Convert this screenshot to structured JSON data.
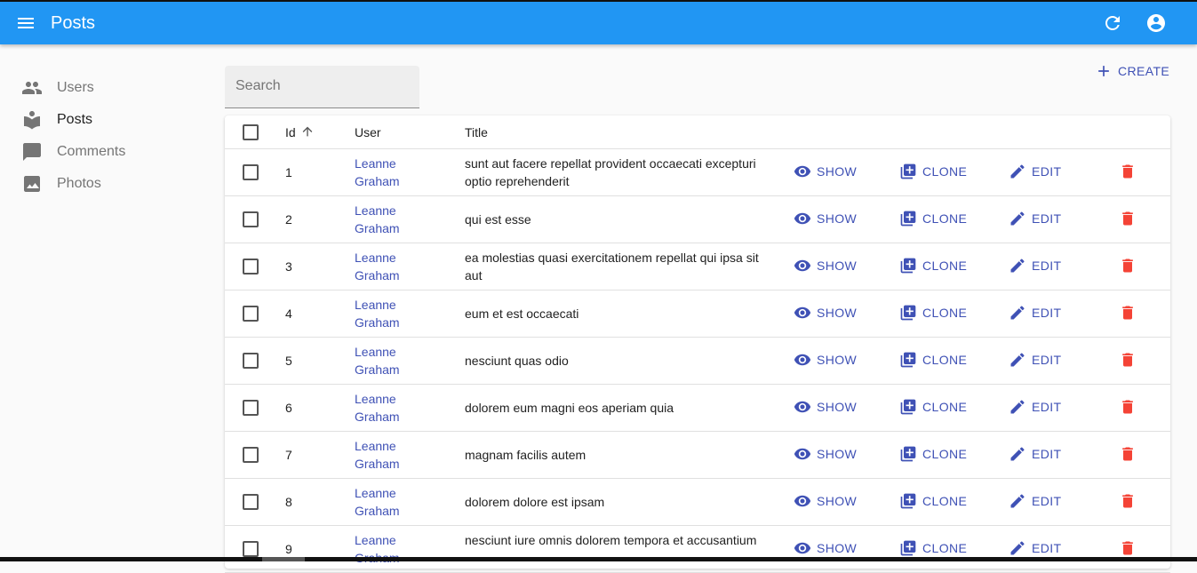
{
  "appbar": {
    "title": "Posts",
    "menu_icon": "menu-icon",
    "refresh_icon": "refresh-icon",
    "account_icon": "account-circle-icon",
    "color": "#2196f3"
  },
  "sidebar": {
    "items": [
      {
        "label": "Users",
        "icon": "users-icon",
        "active": false
      },
      {
        "label": "Posts",
        "icon": "book-icon",
        "active": true
      },
      {
        "label": "Comments",
        "icon": "comment-icon",
        "active": false
      },
      {
        "label": "Photos",
        "icon": "photo-icon",
        "active": false
      }
    ]
  },
  "toolbar": {
    "search_placeholder": "Search",
    "search_value": "",
    "create_label": "CREATE"
  },
  "table": {
    "headers": {
      "id": "Id",
      "user": "User",
      "title": "Title"
    },
    "sort": {
      "column": "Id",
      "direction": "ascending"
    },
    "actions": {
      "show": "SHOW",
      "clone": "CLONE",
      "edit": "EDIT"
    },
    "accent": "#3f51b5",
    "delete_color": "#f44336",
    "rows": [
      {
        "id": "1",
        "user": "Leanne Graham",
        "title": "sunt aut facere repellat provident occaecati excepturi optio reprehenderit"
      },
      {
        "id": "2",
        "user": "Leanne Graham",
        "title": "qui est esse"
      },
      {
        "id": "3",
        "user": "Leanne Graham",
        "title": "ea molestias quasi exercitationem repellat qui ipsa sit aut"
      },
      {
        "id": "4",
        "user": "Leanne Graham",
        "title": "eum et est occaecati"
      },
      {
        "id": "5",
        "user": "Leanne Graham",
        "title": "nesciunt quas odio"
      },
      {
        "id": "6",
        "user": "Leanne Graham",
        "title": "dolorem eum magni eos aperiam quia"
      },
      {
        "id": "7",
        "user": "Leanne Graham",
        "title": "magnam facilis autem"
      },
      {
        "id": "8",
        "user": "Leanne Graham",
        "title": "dolorem dolore est ipsam"
      },
      {
        "id": "9",
        "user": "Leanne Graham",
        "title": "nesciunt iure omnis dolorem tempora et accusantium"
      }
    ]
  }
}
